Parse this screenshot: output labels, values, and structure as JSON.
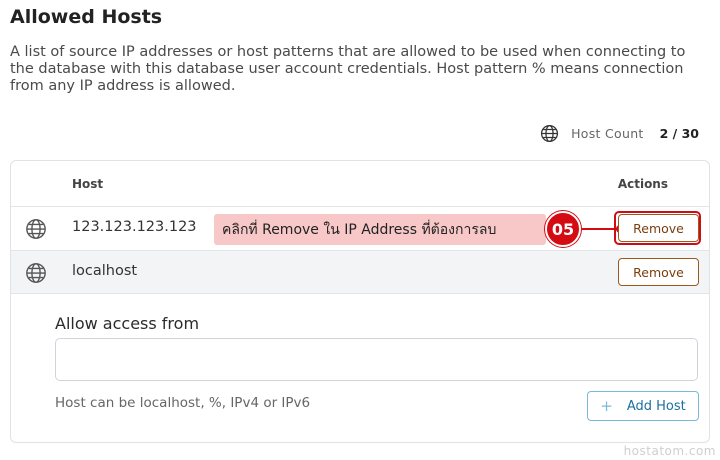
{
  "page": {
    "title": "Allowed Hosts",
    "description": "A list of source IP addresses or host patterns that are allowed to be used when connecting to the database with this database user account credentials. Host pattern % means connection from any IP address is allowed."
  },
  "host_count": {
    "label": "Host Count",
    "value": "2 / 30",
    "icon": "globe-icon"
  },
  "table": {
    "headers": {
      "host": "Host",
      "actions": "Actions"
    },
    "rows": [
      {
        "host": "123.123.123.123",
        "action": "Remove",
        "icon": "globe-icon"
      },
      {
        "host": "localhost",
        "action": "Remove",
        "icon": "globe-icon"
      }
    ]
  },
  "annotation": {
    "text": "คลิกที่ Remove ใน IP Address ที่ต้องการลบ",
    "step": "05",
    "color": "#d40b12",
    "callout_bg": "#f8c8c9"
  },
  "form": {
    "label": "Allow access from",
    "value": "",
    "placeholder": "",
    "hint": "Host can be localhost, %, IPv4 or IPv6",
    "add_button": "Add Host",
    "add_icon": "+"
  },
  "watermark": "hostatom.com",
  "colors": {
    "remove_border": "#9a5a1e",
    "add_border": "#7cb8d8",
    "add_text": "#1d6f9e"
  }
}
